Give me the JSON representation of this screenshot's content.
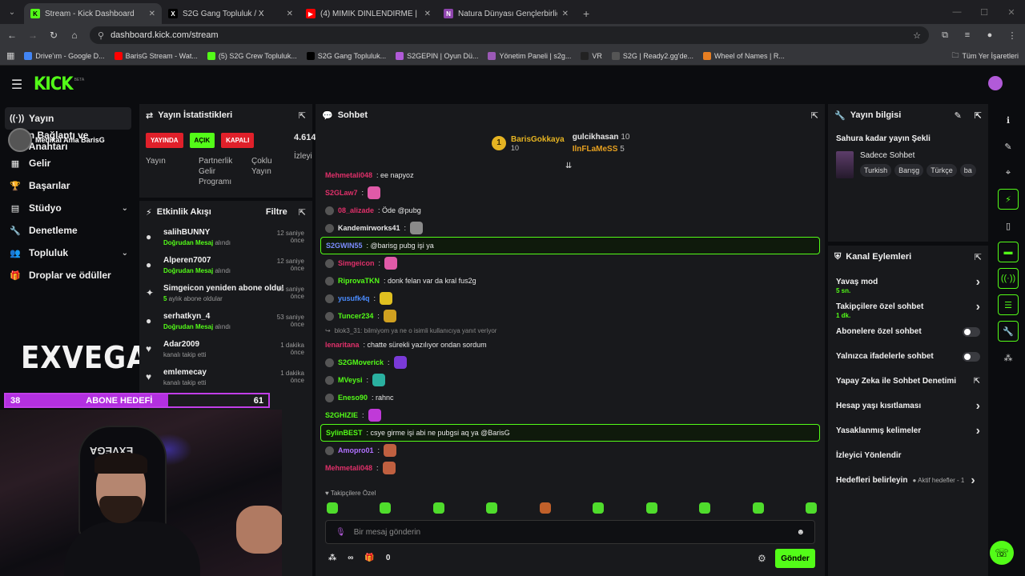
{
  "browser": {
    "tabs": [
      {
        "title": "Stream - Kick Dashboard",
        "fav": "K",
        "color": "#53fc18"
      },
      {
        "title": "S2G Gang Topluluk / X",
        "fav": "X",
        "color": "#000"
      },
      {
        "title": "(4) MİMİK DİNLENDİRME | Ma...",
        "fav": "▶",
        "color": "#ff0000"
      },
      {
        "title": "Natura Dünyası Gençlerbirliği",
        "fav": "N",
        "color": "#8e44ad"
      }
    ],
    "url": "dashboard.kick.com/stream",
    "bookmarks": [
      "Drive'ım - Google D...",
      "BarisG Stream - Wat...",
      "(5) S2G Crew Topluluk...",
      "S2G Gang Topluluk...",
      "S2GEPIN | Oyun Dü...",
      "Yönetim Paneli | s2g...",
      "VR",
      "S2G | Ready2.gg'de...",
      "Wheel of Names | R..."
    ],
    "bookmarks_right": "Tüm Yer İşaretleri"
  },
  "header": {
    "logo": "KICK",
    "beta": "BETA"
  },
  "sidebar": {
    "items": [
      {
        "label": "Yayın",
        "icon": "stream-icon",
        "glyph": "((·))"
      },
      {
        "label": "n Bağlantı ve Anahtarı",
        "icon": "link-icon",
        "glyph": ""
      },
      {
        "label": "Gelir",
        "icon": "revenue-icon",
        "glyph": "▦"
      },
      {
        "label": "Başarılar",
        "icon": "trophy-icon",
        "glyph": "🏆"
      },
      {
        "label": "Stüdyo",
        "icon": "studio-icon",
        "glyph": "▤",
        "chevron": true
      },
      {
        "label": "Denetleme",
        "icon": "wrench-icon",
        "glyph": "🔧"
      },
      {
        "label": "Topluluk",
        "icon": "community-icon",
        "glyph": "👥",
        "chevron": true
      },
      {
        "label": "Droplar ve ödüller",
        "icon": "drops-icon",
        "glyph": "🎁"
      }
    ],
    "overlay_name": "Medikal Ama BarisG",
    "brand": "EXVEGA"
  },
  "goal": {
    "current": "38",
    "label": "ABONE HEDEFİ",
    "target": "61",
    "fill": 0.62
  },
  "webcam": {
    "chair_text": "EXVEGA"
  },
  "stats": {
    "title": "Yayın İstatistikleri",
    "badges": [
      {
        "label": "YAYINDA",
        "bg": "#e0202a",
        "fg": "#fff"
      },
      {
        "label": "AÇIK",
        "bg": "#53fc18",
        "fg": "#000"
      },
      {
        "label": "KAPALI",
        "bg": "#e0202a",
        "fg": "#fff"
      }
    ],
    "labels": [
      "Yayın",
      "Partnerlik Gelir Programı",
      "Çoklu Yayın"
    ],
    "viewers": "4.614",
    "viewers_label": "İzleyi"
  },
  "activity": {
    "title": "Etkinlik Akışı",
    "filter": "Filtre",
    "items": [
      {
        "name": "salihBUNNY",
        "sub_b": "Doğrudan Mesaj",
        "sub": " alındı",
        "time": "12 saniye önce",
        "glyph": "●"
      },
      {
        "name": "Alperen7007",
        "sub_b": "Doğrudan Mesaj",
        "sub": " alındı",
        "time": "12 saniye önce",
        "glyph": "●"
      },
      {
        "name": "Simgeicon yeniden abone oldu!",
        "sub_b": "5",
        "sub": " aylık abone oldular",
        "time": "16 saniye önce",
        "glyph": "✦"
      },
      {
        "name": "serhatkyn_4",
        "sub_b": "Doğrudan Mesaj",
        "sub": " alındı",
        "time": "53 saniye önce",
        "glyph": "●"
      },
      {
        "name": "Adar2009",
        "sub_b": "",
        "sub": "kanalı takip etti",
        "time": "1 dakika önce",
        "glyph": "♥"
      },
      {
        "name": "emlemecay",
        "sub_b": "",
        "sub": "kanalı takip etti",
        "time": "1 dakika önce",
        "glyph": "♥"
      }
    ]
  },
  "chat": {
    "title": "Sohbet",
    "pinned": [
      {
        "name": "BarisGokkaya",
        "count": "10"
      },
      {
        "name": "gulcikhasan",
        "count": "10"
      },
      {
        "name": "IlnFLaMeSS",
        "count": "5"
      }
    ],
    "lines": [
      {
        "user": "Mehmetali048",
        "color": "#e0306a",
        "msg": ": ee napyoz"
      },
      {
        "user": "S2GLaw7",
        "color": "#e0306a",
        "msg": ":",
        "emote": "#e05aa8"
      },
      {
        "user": "08_alizade",
        "color": "#e0306a",
        "msg": ": Öde @pubg",
        "badge": true
      },
      {
        "user": "Kandemirworks41",
        "color": "#e8e8e8",
        "msg": ":",
        "emote": "#8a8a8a",
        "badge": true
      },
      {
        "user": "S2GWIN55",
        "color": "#7b8cff",
        "msg": ": @barisg pubg işi ya",
        "hl": true
      },
      {
        "user": "Simgeicon",
        "color": "#e0306a",
        "msg": ":",
        "emote": "#e05aa8",
        "badge": true
      },
      {
        "user": "RiprovaTKN",
        "color": "#53fc18",
        "msg": ": donk felan var da kral fus2g",
        "badge": true
      },
      {
        "user": "yusufk4q",
        "color": "#4a8cff",
        "msg": ":",
        "emote": "#e0c020",
        "badge": true
      },
      {
        "user": "Tuncer234",
        "color": "#53fc18",
        "msg": ":",
        "emote": "#d0a020",
        "badge": true
      },
      {
        "reply": "blok3_31: bilmiyom ya ne o isimli kullanıcıya yanıt veriyor"
      },
      {
        "user": "lenaritana",
        "color": "#e0306a",
        "msg": ": chatte sürekli yazılıyor ondan sordum"
      },
      {
        "user": "S2GMoverick",
        "color": "#53fc18",
        "msg": ":",
        "emote": "#7a3ad8",
        "badge": true
      },
      {
        "user": "MVeysi",
        "color": "#53fc18",
        "msg": ":",
        "emote": "#2ab0a0",
        "badge": true
      },
      {
        "user": "Eneso90",
        "color": "#53fc18",
        "msg": ": rahnc",
        "badge": true
      },
      {
        "user": "S2GHIZIE",
        "color": "#53fc18",
        "msg": ":",
        "emote": "#c03ad8"
      },
      {
        "user": "SylinBEST",
        "color": "#53fc18",
        "msg": ": csye girme işi abi ne pubgsi aq ya @BarisG",
        "hl": true
      },
      {
        "user": "Amopro01",
        "color": "#b070ff",
        "msg": ":",
        "emote": "#c06040",
        "badge": true
      },
      {
        "user": "Mehmetali048",
        "color": "#e0306a",
        "msg": ":",
        "emote": "#c06040"
      }
    ],
    "followers_only": "Takipçilere Özel",
    "input_placeholder": "Bir mesaj gönderin",
    "infinity": "∞",
    "gift_count": "0",
    "send": "Gönder"
  },
  "info": {
    "title": "Yayın bilgisi",
    "stream_title": "Sahura kadar yayın Şekli",
    "category": "Sadece Sohbet",
    "tags": [
      "Turkish",
      "Barışg",
      "Türkçe",
      "ba"
    ]
  },
  "actions": {
    "title": "Kanal Eylemleri",
    "rows": [
      {
        "label": "Yavaş mod",
        "sub": "5 sn.",
        "type": "chevron"
      },
      {
        "label": "Takipçilere özel sohbet",
        "sub": "1 dk.",
        "type": "chevron"
      },
      {
        "label": "Abonelere özel sohbet",
        "type": "toggle"
      },
      {
        "label": "Yalnızca ifadelerle sohbet",
        "type": "toggle"
      },
      {
        "label": "Yapay Zeka ile Sohbet Denetimi",
        "type": "external"
      },
      {
        "label": "Hesap yaşı kısıtlaması",
        "type": "chevron"
      },
      {
        "label": "Yasaklanmış kelimeler",
        "type": "chevron"
      },
      {
        "label": "İzleyici Yönlendir",
        "type": "none"
      },
      {
        "label": "Hedefleri belirleyin",
        "type": "chevron",
        "extra": "Aktif hedefler - 1"
      }
    ]
  }
}
